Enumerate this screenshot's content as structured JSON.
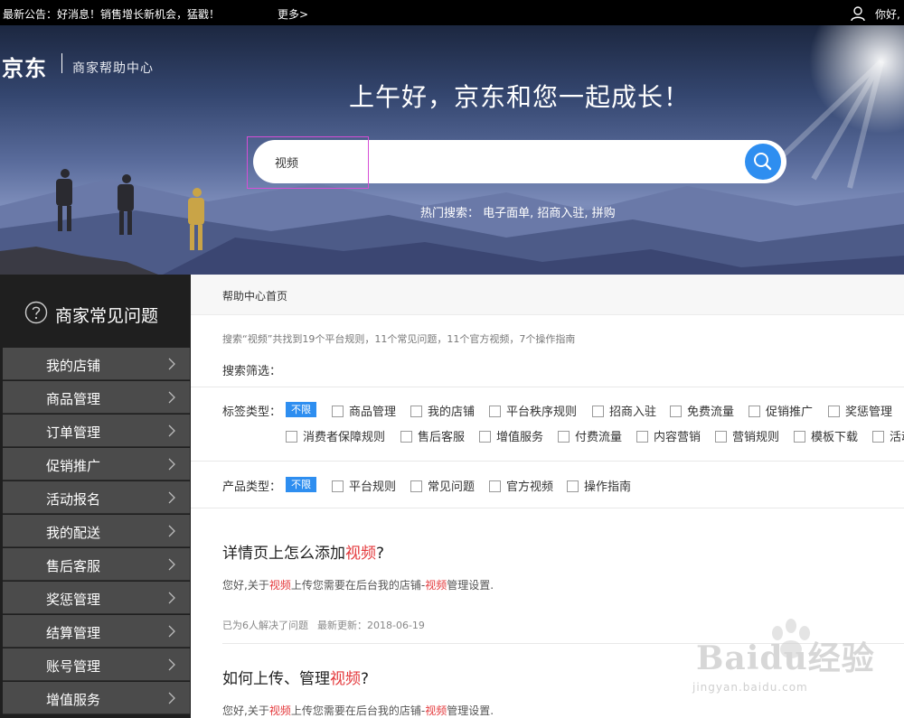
{
  "topbar": {
    "notice": "最新公告：好消息！销售增长新机会，猛戳！",
    "more_link": "更多>",
    "greeting": "你好,"
  },
  "hero": {
    "logo_text": "京东",
    "logo_subtitle": "商家帮助中心",
    "headline": "上午好，京东和您一起成长！",
    "search_value": "视频",
    "hot_search_label": "热门搜索：",
    "hot_search_terms": "电子面单, 招商入驻, 拼购"
  },
  "sidebar": {
    "title": "商家常见问题",
    "items": [
      {
        "label": "我的店铺"
      },
      {
        "label": "商品管理"
      },
      {
        "label": "订单管理"
      },
      {
        "label": "促销推广"
      },
      {
        "label": "活动报名"
      },
      {
        "label": "我的配送"
      },
      {
        "label": "售后客服"
      },
      {
        "label": "奖惩管理"
      },
      {
        "label": "结算管理"
      },
      {
        "label": "账号管理"
      },
      {
        "label": "增值服务"
      }
    ]
  },
  "main": {
    "breadcrumb": "帮助中心首页",
    "summary": "搜索“视频”共找到19个平台规则，11个常见问题，11个官方视频，7个操作指南",
    "filter_title": "搜索筛选：",
    "tag_type": {
      "label": "标签类型：",
      "badge": "不限",
      "options_row1": [
        "商品管理",
        "我的店铺",
        "平台秩序规则",
        "招商入驻",
        "免费流量",
        "促销推广",
        "奖惩管理"
      ],
      "options_row2": [
        "消费者保障规则",
        "售后客服",
        "增值服务",
        "付费流量",
        "内容营销",
        "营销规则",
        "模板下载",
        "活动"
      ]
    },
    "product_type": {
      "label": "产品类型：",
      "badge": "不限",
      "options": [
        "平台规则",
        "常见问题",
        "官方视频",
        "操作指南"
      ]
    },
    "results": [
      {
        "title_before": "详情页上怎么添加",
        "title_highlight": "视频",
        "title_after": "?",
        "desc_before": "您好,关于",
        "desc_hl1": "视频",
        "desc_mid": "上传您需要在后台我的店铺-",
        "desc_hl2": "视频",
        "desc_after": "管理设置.",
        "solved": "已为6人解决了问题",
        "updated": "最新更新：2018-06-19"
      },
      {
        "title_before": "如何上传、管理",
        "title_highlight": "视频",
        "title_after": "?",
        "desc_before": "您好,关于",
        "desc_hl1": "视频",
        "desc_mid": "上传您需要在后台我的店铺-",
        "desc_hl2": "视频",
        "desc_after": "管理设置."
      }
    ]
  },
  "watermark": {
    "text": "Baidu经验",
    "url": "jingyan.baidu.com"
  },
  "colors": {
    "accent_blue": "#2e8ef0",
    "highlight_red": "#e4393c",
    "sidebar_bg": "#1f1f1f",
    "menu_bg": "#4b4b4b"
  }
}
